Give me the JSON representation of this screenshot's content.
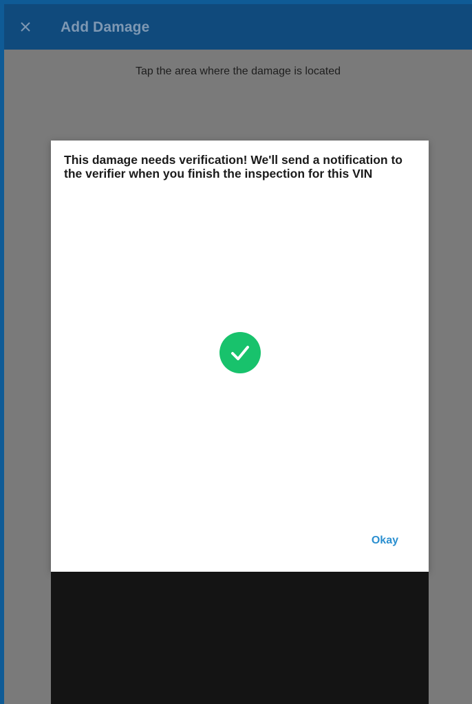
{
  "app_bar": {
    "title": "Add Damage",
    "close_icon": "close-icon"
  },
  "instruction": "Tap the area where the damage is located",
  "dialog": {
    "message": "This damage needs verification! We'll send a notification to the verifier when you finish the inspection for this VIN",
    "status_icon": "check-circle-icon",
    "okay_label": "Okay"
  },
  "colors": {
    "app_bar": "#104a7c",
    "scrim": "#7a7a7a",
    "success": "#18c26c",
    "accent": "#2a8fd0"
  }
}
